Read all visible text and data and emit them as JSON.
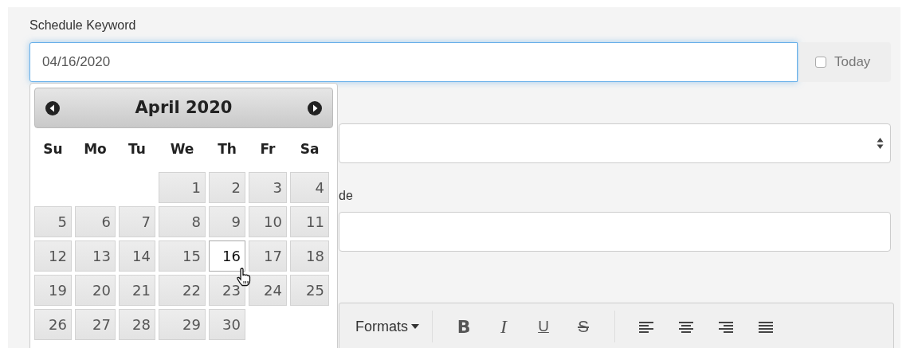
{
  "schedule_field": {
    "label": "Schedule Keyword",
    "value": "04/16/2020"
  },
  "today_option": {
    "label": "Today",
    "checked": false
  },
  "partial_label": "de",
  "editor_toolbar": {
    "formats": "Formats",
    "buttons": [
      {
        "kind": "bold",
        "label": "B"
      },
      {
        "kind": "italic",
        "label": "I"
      },
      {
        "kind": "underline",
        "label": "U"
      },
      {
        "kind": "strike",
        "label": "S"
      },
      {
        "kind": "align-left"
      },
      {
        "kind": "align-center"
      },
      {
        "kind": "align-right"
      },
      {
        "kind": "justify"
      }
    ]
  },
  "calendar": {
    "title": "April 2020",
    "weekdays": [
      "Su",
      "Mo",
      "Tu",
      "We",
      "Th",
      "Fr",
      "Sa"
    ],
    "weeks": [
      [
        {
          "kind": "blank"
        },
        {
          "kind": "blank"
        },
        {
          "kind": "blank"
        },
        {
          "kind": "day",
          "label": "1",
          "selected": false
        },
        {
          "kind": "day",
          "label": "2",
          "selected": false
        },
        {
          "kind": "day",
          "label": "3",
          "selected": false
        },
        {
          "kind": "day",
          "label": "4",
          "selected": false
        }
      ],
      [
        {
          "kind": "day",
          "label": "5",
          "selected": false
        },
        {
          "kind": "day",
          "label": "6",
          "selected": false
        },
        {
          "kind": "day",
          "label": "7",
          "selected": false
        },
        {
          "kind": "day",
          "label": "8",
          "selected": false
        },
        {
          "kind": "day",
          "label": "9",
          "selected": false
        },
        {
          "kind": "day",
          "label": "10",
          "selected": false
        },
        {
          "kind": "day",
          "label": "11",
          "selected": false
        }
      ],
      [
        {
          "kind": "day",
          "label": "12",
          "selected": false
        },
        {
          "kind": "day",
          "label": "13",
          "selected": false
        },
        {
          "kind": "day",
          "label": "14",
          "selected": false
        },
        {
          "kind": "day",
          "label": "15",
          "selected": false
        },
        {
          "kind": "day",
          "label": "16",
          "selected": true
        },
        {
          "kind": "day",
          "label": "17",
          "selected": false
        },
        {
          "kind": "day",
          "label": "18",
          "selected": false
        }
      ],
      [
        {
          "kind": "day",
          "label": "19",
          "selected": false
        },
        {
          "kind": "day",
          "label": "20",
          "selected": false
        },
        {
          "kind": "day",
          "label": "21",
          "selected": false
        },
        {
          "kind": "day",
          "label": "22",
          "selected": false
        },
        {
          "kind": "day",
          "label": "23",
          "selected": false
        },
        {
          "kind": "day",
          "label": "24",
          "selected": false
        },
        {
          "kind": "day",
          "label": "25",
          "selected": false
        }
      ],
      [
        {
          "kind": "day",
          "label": "26",
          "selected": false
        },
        {
          "kind": "day",
          "label": "27",
          "selected": false
        },
        {
          "kind": "day",
          "label": "28",
          "selected": false
        },
        {
          "kind": "day",
          "label": "29",
          "selected": false
        },
        {
          "kind": "day",
          "label": "30",
          "selected": false
        },
        {
          "kind": "blank"
        },
        {
          "kind": "blank"
        }
      ]
    ]
  }
}
